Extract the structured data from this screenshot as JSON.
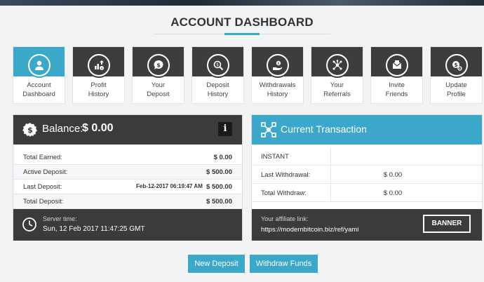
{
  "page": {
    "title": "ACCOUNT DASHBOARD"
  },
  "colors": {
    "accent": "#3ba7c9",
    "dark": "#3b3b3b"
  },
  "nav": {
    "tiles": [
      {
        "line1": "Account",
        "line2": "Dashboard",
        "icon": "user-icon",
        "active": true
      },
      {
        "line1": "Profit",
        "line2": "History",
        "icon": "profit-chart-icon",
        "active": false
      },
      {
        "line1": "Your",
        "line2": "Deposit",
        "icon": "dollar-bubble-icon",
        "active": false
      },
      {
        "line1": "Deposit",
        "line2": "History",
        "icon": "magnifier-dollar-icon",
        "active": false
      },
      {
        "line1": "Withdrawals",
        "line2": "History",
        "icon": "hand-coin-icon",
        "active": false
      },
      {
        "line1": "Your",
        "line2": "Referrals",
        "icon": "network-icon",
        "active": false
      },
      {
        "line1": "Invite",
        "line2": "Friends",
        "icon": "envelope-icon",
        "active": false
      },
      {
        "line1": "Update",
        "line2": "Profile",
        "icon": "dollar-gear-icon",
        "active": false
      }
    ]
  },
  "balance": {
    "label": "Balance:",
    "value": "$ 0.00",
    "info": "i",
    "rows": [
      {
        "label": "Total Earned:",
        "date": "",
        "value": "$ 0.00"
      },
      {
        "label": "Active Deposit:",
        "date": "",
        "value": "$ 500.00"
      },
      {
        "label": "Last Deposit:",
        "date": "Feb-12-2017 06:19:47 AM",
        "value": "$ 500.00"
      },
      {
        "label": "Total Deposit:",
        "date": "",
        "value": "$ 500.00"
      }
    ],
    "server_label": "Server time:",
    "server_time": "Sun, 12 Feb 2017 11:47:25 GMT"
  },
  "transaction": {
    "title": "Current Transaction",
    "rows": [
      {
        "label": "INSTANT",
        "value": ""
      },
      {
        "label": "Last Withdrawal:",
        "value": "$ 0.00"
      },
      {
        "label": "Total Withdraw:",
        "value": "$ 0.00"
      }
    ],
    "affiliate_label": "Your affiliate link:",
    "affiliate_link": "https://modernbitcoin.biz/ref/yami",
    "banner_label": "BANNER"
  },
  "actions": {
    "new_deposit": "New Deposit",
    "withdraw": "Withdraw Funds"
  }
}
